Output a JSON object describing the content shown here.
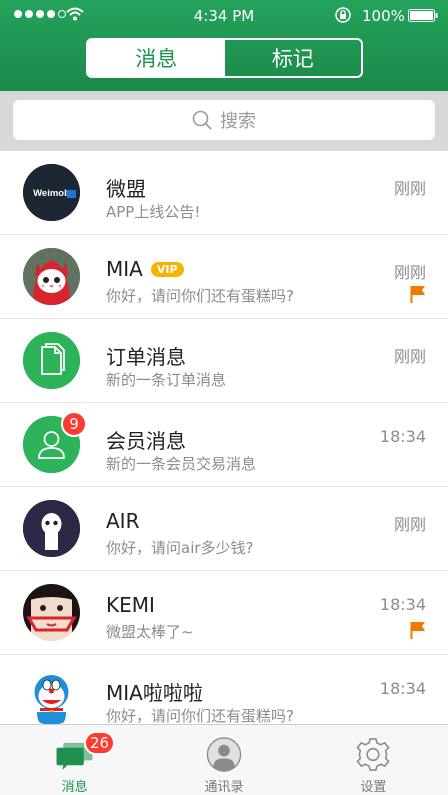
{
  "status_bar": {
    "time": "4:34 PM",
    "battery": "100%"
  },
  "segment": {
    "tabs": [
      "消息",
      "标记"
    ],
    "active": 0
  },
  "search": {
    "placeholder": "搜索"
  },
  "messages": [
    {
      "name": "微盟",
      "preview": "APP上线公告!",
      "time": "刚刚",
      "avatar": "weimob-logo",
      "logo_text": "Weimob 微盟"
    },
    {
      "name": "MIA",
      "vip": "VIP",
      "preview": "你好，请问你们还有蛋糕吗?",
      "time": "刚刚",
      "flag": true,
      "avatar": "cat-avatar"
    },
    {
      "name": "订单消息",
      "preview": "新的一条订单消息",
      "time": "刚刚",
      "avatar": "document-icon"
    },
    {
      "name": "会员消息",
      "preview": "新的一条会员交易消息",
      "time": "18:34",
      "badge": "9",
      "avatar": "person-icon"
    },
    {
      "name": "AIR",
      "preview": "你好，请问air多少钱?",
      "time": "刚刚",
      "avatar": "ghost-avatar"
    },
    {
      "name": "KEMI",
      "preview": "微盟太棒了~",
      "time": "18:34",
      "flag": true,
      "avatar": "girl-avatar"
    },
    {
      "name": "MIA啦啦啦",
      "preview": "你好，请问你们还有蛋糕吗?",
      "time": "18:34",
      "avatar": "doraemon-avatar"
    }
  ],
  "tabbar": {
    "items": [
      {
        "label": "消息",
        "badge": "26",
        "icon": "chat-icon"
      },
      {
        "label": "通讯录",
        "icon": "contacts-icon"
      },
      {
        "label": "设置",
        "icon": "gear-icon"
      }
    ],
    "active": 0
  },
  "colors": {
    "brand_green": "#1e9150",
    "badge_red": "#ff3b30",
    "flag_orange": "#f07800",
    "vip_gold": "#f5b400"
  }
}
